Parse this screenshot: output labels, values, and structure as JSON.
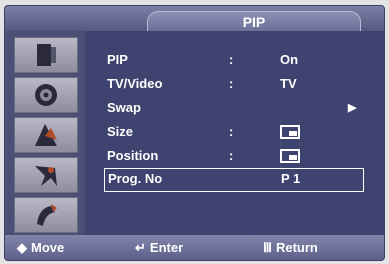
{
  "title": "PIP",
  "sidebar": {
    "items": [
      {
        "icon": "picture-icon"
      },
      {
        "icon": "sound-icon"
      },
      {
        "icon": "channel-icon"
      },
      {
        "icon": "setup-icon"
      },
      {
        "icon": "input-icon"
      }
    ]
  },
  "menu": {
    "rows": [
      {
        "label": "PIP",
        "colon": ":",
        "value": "On"
      },
      {
        "label": "TV/Video",
        "colon": ":",
        "value": "TV"
      },
      {
        "label": "Swap",
        "arrow": "▶"
      },
      {
        "label": "Size",
        "colon": ":",
        "value_icon": "pip-size-icon"
      },
      {
        "label": "Position",
        "colon": ":",
        "value_icon": "pip-position-icon"
      },
      {
        "label": "Prog. No",
        "value": "P  1",
        "selected": true
      }
    ]
  },
  "footer": {
    "move": {
      "glyph": "◆",
      "label": "Move"
    },
    "enter": {
      "glyph": "↵",
      "label": "Enter"
    },
    "return": {
      "glyph": "Ⅲ",
      "label": "Return"
    }
  }
}
